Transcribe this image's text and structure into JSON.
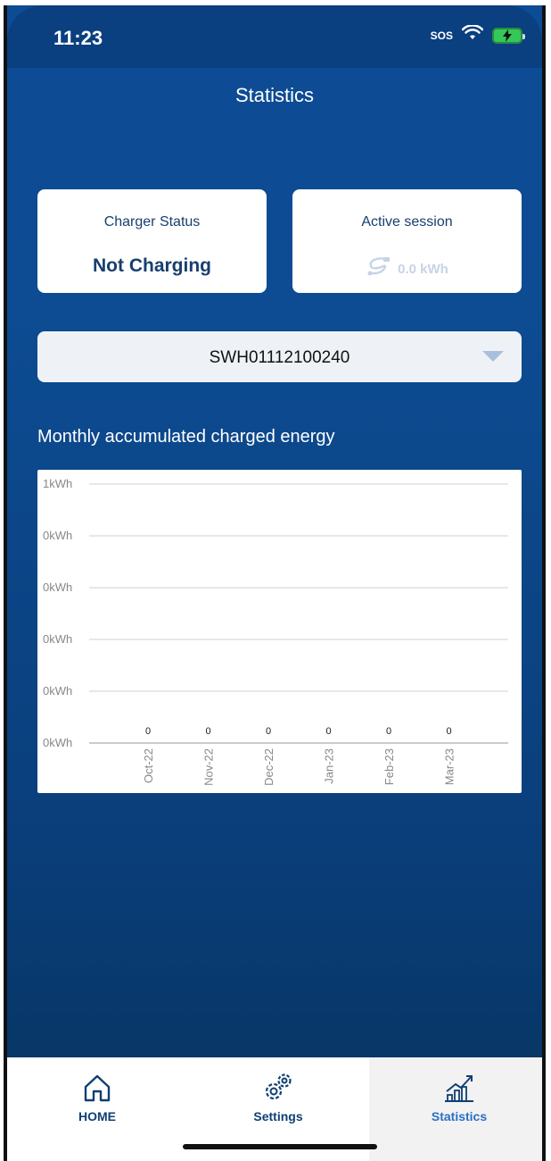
{
  "status_bar": {
    "time": "11:23",
    "sos": "SOS"
  },
  "header": {
    "title": "Statistics"
  },
  "charger_status": {
    "label": "Charger Status",
    "value": "Not Charging"
  },
  "active_session": {
    "label": "Active session",
    "value": "0.0 kWh"
  },
  "charger_select": {
    "selected": "SWH01112100240"
  },
  "section": {
    "title": "Monthly accumulated charged energy"
  },
  "chart_data": {
    "type": "bar",
    "title": "",
    "xlabel": "",
    "ylabel": "",
    "categories": [
      "Oct-22",
      "Nov-22",
      "Dec-22",
      "Jan-23",
      "Feb-23",
      "Mar-23"
    ],
    "values": [
      0,
      0,
      0,
      0,
      0,
      0
    ],
    "value_labels": [
      "0",
      "0",
      "0",
      "0",
      "0",
      "0"
    ],
    "y_tick_labels": [
      "1kWh",
      "0kWh",
      "0kWh",
      "0kWh",
      "0kWh",
      "0kWh"
    ],
    "ylim": [
      0,
      1
    ],
    "grid": true,
    "colors": {
      "bar": "#2a6fc4",
      "grid": "#d0d0d0",
      "tick": "#888888"
    }
  },
  "tabbar": {
    "items": [
      {
        "label": "HOME",
        "icon": "home-icon",
        "active": false
      },
      {
        "label": "Settings",
        "icon": "gear-icon",
        "active": false
      },
      {
        "label": "Statistics",
        "icon": "chart-icon",
        "active": true
      }
    ]
  },
  "colors": {
    "primary": "#0d4c95",
    "text_dark": "#173f6e",
    "active_tab": "#2a6fc4"
  }
}
